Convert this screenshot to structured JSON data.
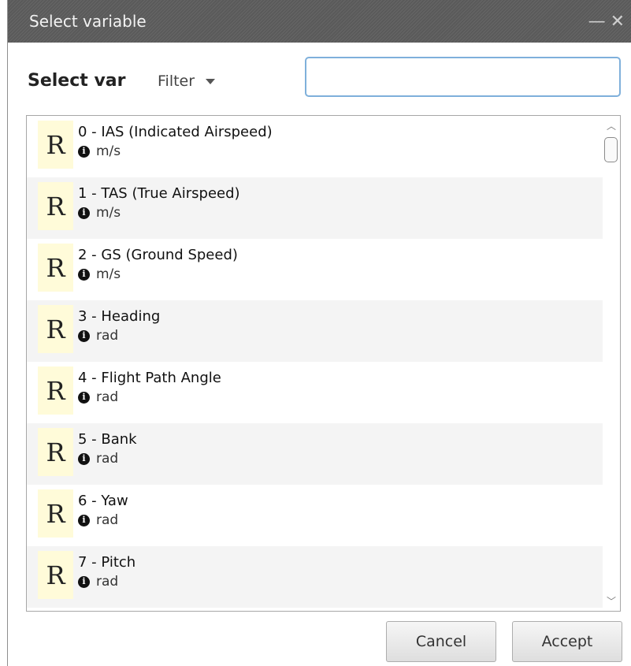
{
  "window": {
    "title": "Select variable",
    "minimize_glyph": "—",
    "close_glyph": "✕"
  },
  "search": {
    "label": "Select var",
    "filter_label": "Filter",
    "input_value": "",
    "input_placeholder": ""
  },
  "list": {
    "items": [
      {
        "badge": "R",
        "name": "0 - IAS (Indicated Airspeed)",
        "unit": "m/s"
      },
      {
        "badge": "R",
        "name": "1 - TAS (True Airspeed)",
        "unit": "m/s"
      },
      {
        "badge": "R",
        "name": "2 - GS (Ground Speed)",
        "unit": "m/s"
      },
      {
        "badge": "R",
        "name": "3 - Heading",
        "unit": "rad"
      },
      {
        "badge": "R",
        "name": "4 - Flight Path Angle",
        "unit": "rad"
      },
      {
        "badge": "R",
        "name": "5 - Bank",
        "unit": "rad"
      },
      {
        "badge": "R",
        "name": "6 - Yaw",
        "unit": "rad"
      },
      {
        "badge": "R",
        "name": "7 - Pitch",
        "unit": "rad"
      }
    ],
    "info_glyph": "i"
  },
  "buttons": {
    "cancel": "Cancel",
    "accept": "Accept"
  },
  "colors": {
    "titlebar": "#5f5f5f",
    "badge_bg": "#fffbd9",
    "input_border": "#7fb0db"
  }
}
